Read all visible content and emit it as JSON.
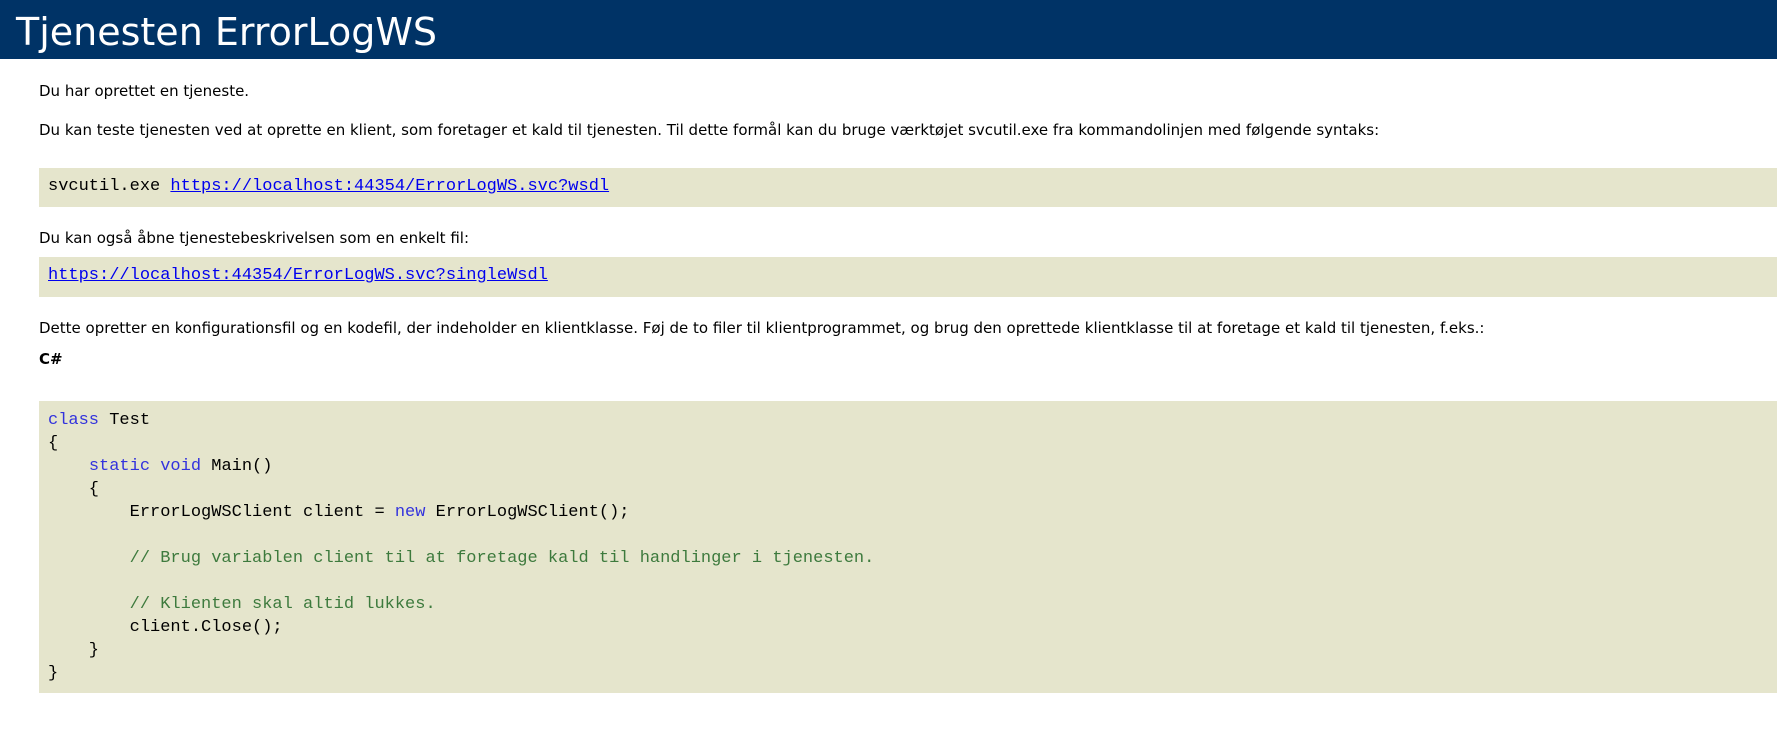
{
  "heading": "Tjenesten ErrorLogWS",
  "intro": "Du har oprettet en tjeneste.",
  "test_instructions": "Du kan teste tjenesten ved at oprette en klient, som foretager et kald til tjenesten. Til dette formål kan du bruge værktøjet svcutil.exe fra kommandolinjen med følgende syntaks:",
  "svcutil_command": "svcutil.exe",
  "wsdl_url": "https://localhost:44354/ErrorLogWS.svc?wsdl",
  "single_file_text": "Du kan også åbne tjenestebeskrivelsen som en enkelt fil:",
  "single_wsdl_url": "https://localhost:44354/ErrorLogWS.svc?singleWsdl",
  "config_text": "Dette opretter en konfigurationsfil og en kodefil, der indeholder en klientklasse. Føj de to filer til klientprogrammet, og brug den oprettede klientklasse til at foretage et kald til tjenesten, f.eks.:",
  "language_label": "C#",
  "code": {
    "kw_class": "class",
    "class_name": " Test",
    "open_brace": "{",
    "indent1": "    ",
    "kw_static": "static",
    "kw_void": "void",
    "main_sig": " Main()",
    "inner_open": "    {",
    "client_decl": "        ErrorLogWSClient client = ",
    "kw_new": "new",
    "client_ctor": " ErrorLogWSClient();",
    "comment1": "        // Brug variablen client til at foretage kald til handlinger i tjenesten.",
    "comment2": "        // Klienten skal altid lukkes.",
    "close_call": "        client.Close();",
    "inner_close": "    }",
    "close_brace": "}"
  }
}
